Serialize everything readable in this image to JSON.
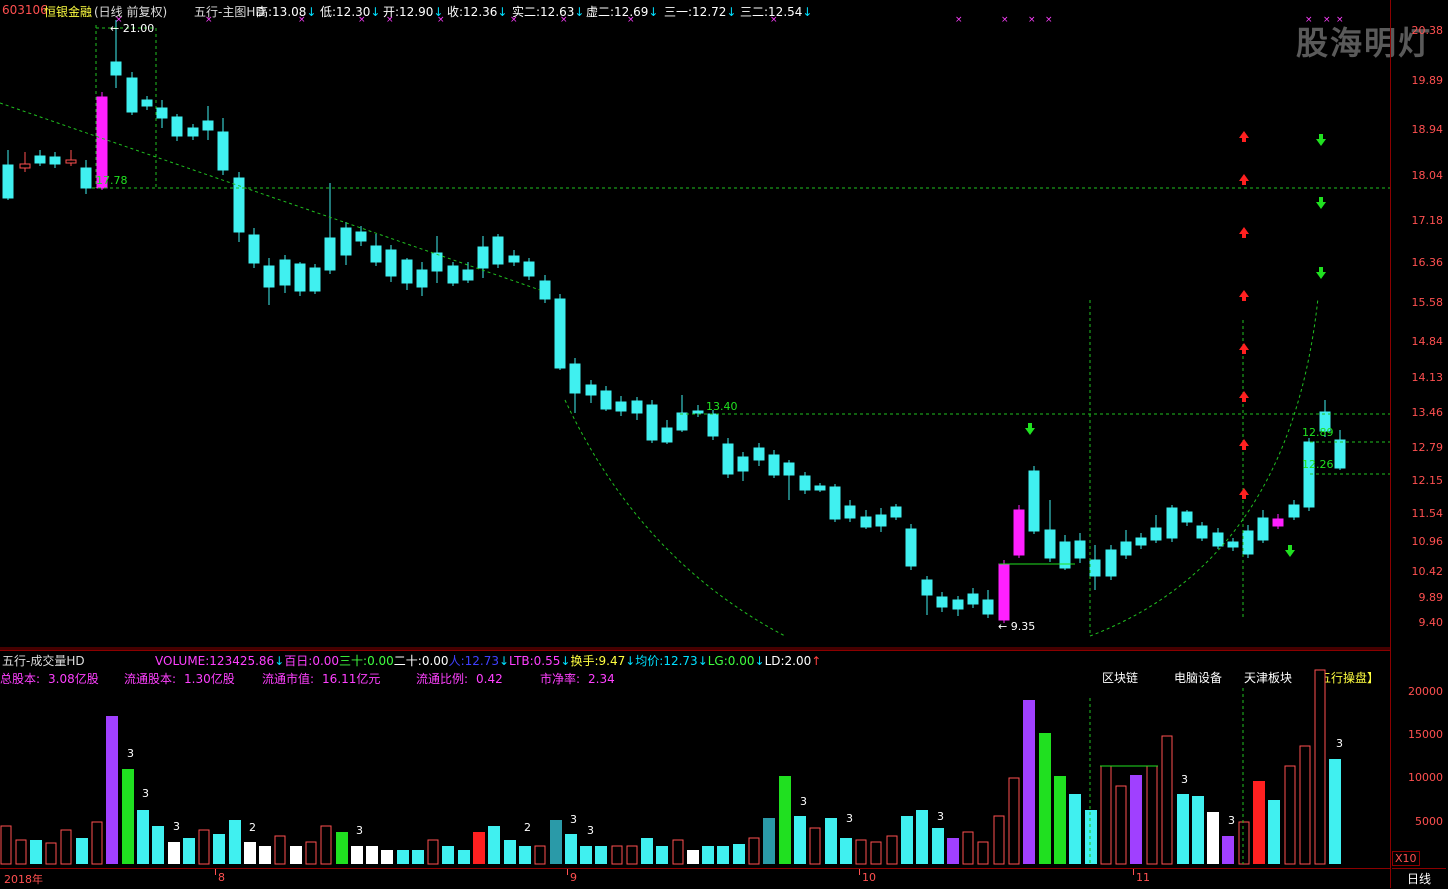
{
  "header": {
    "code": "603106",
    "name": "恒银金融",
    "mode": "(日线 前复权)",
    "indicator": "五行-主图HD",
    "stats": [
      {
        "label": "高:",
        "value": "13.08",
        "dir": "down"
      },
      {
        "label": "低:",
        "value": "12.30",
        "dir": "down"
      },
      {
        "label": "开:",
        "value": "12.90",
        "dir": "down"
      },
      {
        "label": "收:",
        "value": "12.36",
        "dir": "down"
      },
      {
        "label": "实二:",
        "value": "12.63",
        "dir": "down"
      },
      {
        "label": "虚二:",
        "value": "12.69",
        "dir": "down"
      },
      {
        "label": "三一:",
        "value": "12.72",
        "dir": "down"
      },
      {
        "label": "三二:",
        "value": "12.54",
        "dir": "down"
      }
    ]
  },
  "price_axis": {
    "labels": [
      "20.38",
      "19.89",
      "18.94",
      "18.04",
      "17.18",
      "16.36",
      "15.58",
      "14.84",
      "14.13",
      "13.46",
      "12.79",
      "12.15",
      "11.54",
      "10.96",
      "10.42",
      "9.89",
      "9.40"
    ]
  },
  "annotations": {
    "high_label": "21.00",
    "left_level": "17.78",
    "mid_level": "13.40",
    "low_label": "9.35",
    "right_level1": "12.89",
    "right_level2": "12.26"
  },
  "volume_panel": {
    "title": "五行-成交量HD",
    "stats": [
      {
        "label": "VOLUME:",
        "value": "123425.86",
        "dir": "down",
        "color": "#ff40ff"
      },
      {
        "label": "百日:",
        "value": "0.00",
        "dir": "",
        "color": "#ff40ff"
      },
      {
        "label": "三十:",
        "value": "0.00",
        "dir": "",
        "color": "#40ff40"
      },
      {
        "label": "二十:",
        "value": "0.00",
        "dir": "",
        "color": "#ffffff"
      },
      {
        "label": "人:",
        "value": "12.73",
        "dir": "down",
        "color": "#4040ff"
      },
      {
        "label": "LTB:",
        "value": "0.55",
        "dir": "down",
        "color": "#ff40ff"
      },
      {
        "label": "换手:",
        "value": "9.47",
        "dir": "down",
        "color": "#ffff40"
      },
      {
        "label": "均价:",
        "value": "12.73",
        "dir": "down",
        "color": "#00e0ff"
      },
      {
        "label": "LG:",
        "value": "0.00",
        "dir": "down",
        "color": "#40ff40"
      },
      {
        "label": "LD:",
        "value": "2.00",
        "dir": "up",
        "color": "#ffffff"
      }
    ],
    "axis_labels": [
      "20000",
      "15000",
      "10000",
      "5000"
    ],
    "scale_label": "X10"
  },
  "capital": {
    "items": [
      {
        "label": "总股本:",
        "value": "3.08亿股"
      },
      {
        "label": "流通股本:",
        "value": "1.30亿股"
      },
      {
        "label": "流通市值:",
        "value": "16.11亿元"
      },
      {
        "label": "流通比例:",
        "value": "0.42"
      },
      {
        "label": "市净率:",
        "value": "2.34"
      }
    ]
  },
  "sectors": [
    "区块链",
    "电脑设备",
    "天津板块",
    "【五行操盘】"
  ],
  "time_axis": {
    "labels": [
      "2018年",
      "8",
      "9",
      "10",
      "11"
    ]
  },
  "period_button": "日线",
  "watermark": "股海明灯",
  "colors": {
    "bull": "#ff5050",
    "bear": "#40f0f0",
    "magenta": "#ff20ff",
    "green": "#20e020",
    "purple": "#a040ff",
    "grid": "#8b0000"
  }
}
